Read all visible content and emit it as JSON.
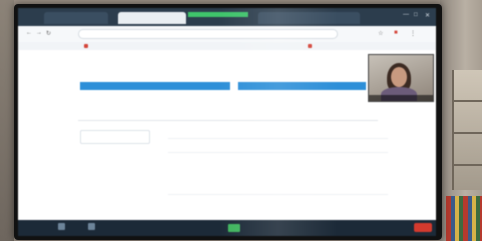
{
  "browser": {
    "tabs": [
      "",
      "",
      "",
      "",
      ""
    ],
    "url": "",
    "bookmarks": [
      "",
      "",
      "",
      "",
      "",
      ""
    ]
  },
  "page": {
    "logo": "",
    "columns": [
      "",
      "",
      "",
      "",
      ""
    ],
    "section_tabs": [
      "",
      "",
      ""
    ],
    "sidebar": [
      "",
      "",
      ""
    ],
    "rows": [
      {
        "label": "",
        "value": ""
      },
      {
        "label": "",
        "value": ""
      },
      {
        "label": "",
        "value": ""
      },
      {
        "label": "",
        "value": ""
      },
      {
        "label": "",
        "value": ""
      }
    ],
    "section_title": ""
  },
  "video": {
    "name": ""
  },
  "taskbar": {
    "items": [
      "",
      "",
      "",
      "",
      "",
      ""
    ]
  },
  "colors": {
    "browser_chrome": "#2c3d4d",
    "progress_blue": "#2d8fd8",
    "zoom_green": "#3fb45e",
    "end_red": "#d33a2e"
  }
}
